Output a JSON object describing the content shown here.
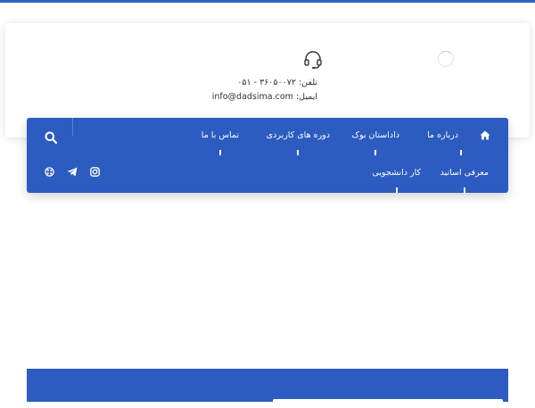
{
  "header": {
    "phone_label": "تلفن:",
    "phone_value": "۰۵۱ - ۳۶۰۵۰۰۷۲",
    "email_label": "ایمیل:",
    "email_value": "info@dadsima.com"
  },
  "nav": {
    "items": [
      {
        "label": "درباره ما"
      },
      {
        "label": "داداستان بوک"
      },
      {
        "label": "دوره های کاربردی"
      },
      {
        "label": "تماس با ما"
      },
      {
        "label": "معرفی اساتید"
      },
      {
        "label": "کار دانشجویی"
      }
    ]
  },
  "icons": {
    "headset": "headset-icon",
    "home": "home-icon",
    "search": "search-icon",
    "instagram": "instagram-icon",
    "telegram": "telegram-icon",
    "aparat": "aparat-icon"
  },
  "colors": {
    "brand": "#2c5cbf",
    "text": "#333333"
  }
}
